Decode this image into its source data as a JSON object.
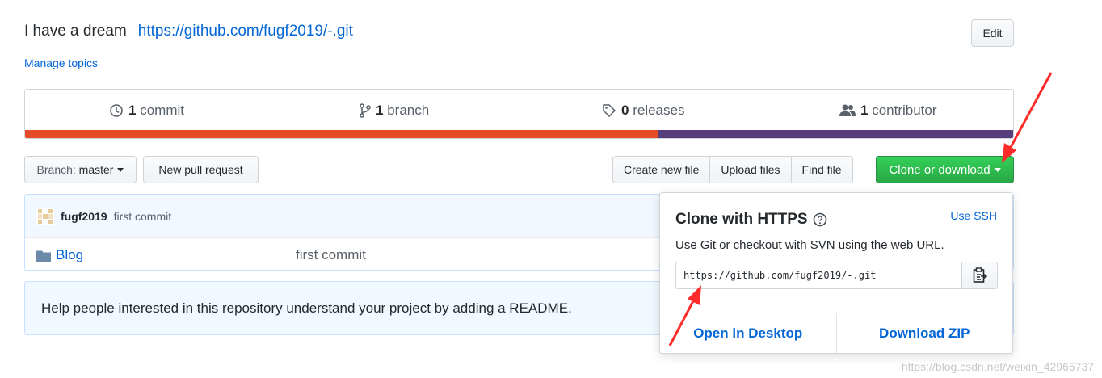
{
  "repo": {
    "description": "I have a dream",
    "url": "https://github.com/fugf2019/-.git",
    "manage_topics": "Manage topics",
    "edit_label": "Edit"
  },
  "summary": {
    "commits_count": "1",
    "commits_label": "commit",
    "branches_count": "1",
    "branches_label": "branch",
    "releases_count": "0",
    "releases_label": "releases",
    "contributors_count": "1",
    "contributors_label": "contributor"
  },
  "language_bar": [
    {
      "color": "#e34c26",
      "fraction": 0.641
    },
    {
      "color": "#563d7c",
      "fraction": 0.359
    }
  ],
  "toolbar": {
    "branch_prefix": "Branch:",
    "branch_name": "master",
    "new_pull_request": "New pull request",
    "create_new_file": "Create new file",
    "upload_files": "Upload files",
    "find_file": "Find file",
    "clone_or_download": "Clone or download"
  },
  "latest_commit": {
    "author": "fugf2019",
    "message": "first commit"
  },
  "files": [
    {
      "name": "Blog",
      "type": "folder",
      "message": "first commit"
    }
  ],
  "readme_prompt": "Help people interested in this repository understand your project by adding a README.",
  "clone_popover": {
    "title": "Clone with HTTPS",
    "use_ssh": "Use SSH",
    "hint": "Use Git or checkout with SVN using the web URL.",
    "url": "https://github.com/fugf2019/-.git",
    "open_in_desktop": "Open in Desktop",
    "download_zip": "Download ZIP"
  },
  "watermark": "https://blog.csdn.net/weixin_42965737",
  "colors": {
    "link": "#0366d6",
    "primary_button": "#28a745",
    "annotation_arrow": "#ff2a2a"
  }
}
